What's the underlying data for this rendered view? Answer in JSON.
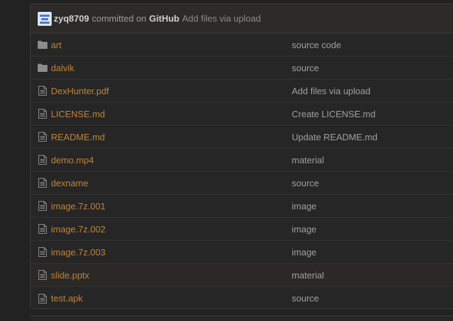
{
  "commit": {
    "author": "zyq8709",
    "committed_text": "committed on",
    "via": "GitHub",
    "message": "Add files via upload"
  },
  "files": [
    {
      "name": "art",
      "type": "folder",
      "icon": "folder-icon",
      "message": "source code"
    },
    {
      "name": "dalvik",
      "type": "folder",
      "icon": "folder-icon",
      "message": "source"
    },
    {
      "name": "DexHunter.pdf",
      "type": "file",
      "icon": "file-icon",
      "message": "Add files via upload"
    },
    {
      "name": "LICENSE.md",
      "type": "file",
      "icon": "file-icon",
      "message": "Create LICENSE.md"
    },
    {
      "name": "README.md",
      "type": "file",
      "icon": "file-icon",
      "message": "Update README.md"
    },
    {
      "name": "demo.mp4",
      "type": "file",
      "icon": "file-icon",
      "message": "material"
    },
    {
      "name": "dexname",
      "type": "file",
      "icon": "file-icon",
      "message": "source"
    },
    {
      "name": "image.7z.001",
      "type": "file",
      "icon": "file-icon",
      "message": "image"
    },
    {
      "name": "image.7z.002",
      "type": "file",
      "icon": "file-icon",
      "message": "image"
    },
    {
      "name": "image.7z.003",
      "type": "file",
      "icon": "file-icon",
      "message": "image"
    },
    {
      "name": "slide.pptx",
      "type": "file",
      "icon": "file-icon",
      "message": "material"
    },
    {
      "name": "test.apk",
      "type": "file",
      "icon": "file-icon",
      "message": "source"
    }
  ],
  "colors": {
    "link": "#c0843a",
    "text": "#a0a0a0",
    "background": "#222222"
  }
}
